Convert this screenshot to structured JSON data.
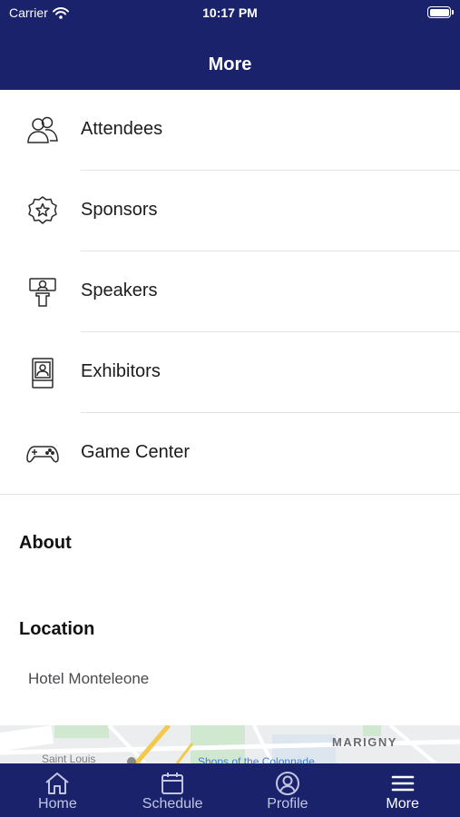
{
  "status_bar": {
    "carrier": "Carrier",
    "time": "10:17 PM",
    "wifi_icon": "wifi-icon",
    "battery_icon": "battery-icon"
  },
  "header": {
    "title": "More"
  },
  "menu": {
    "items": [
      {
        "label": "Attendees",
        "icon": "attendees-icon"
      },
      {
        "label": "Sponsors",
        "icon": "sponsor-badge-icon"
      },
      {
        "label": "Speakers",
        "icon": "speaker-podium-icon"
      },
      {
        "label": "Exhibitors",
        "icon": "exhibitor-booth-icon"
      },
      {
        "label": "Game Center",
        "icon": "game-controller-icon"
      }
    ]
  },
  "about": {
    "heading": "About"
  },
  "location": {
    "heading": "Location",
    "name": "Hotel Monteleone",
    "map": {
      "district_label": "MARIGNY",
      "street_label": "Saint Louis",
      "poi_label": "Shops of the Colonnade"
    }
  },
  "tabbar": {
    "tabs": [
      {
        "label": "Home",
        "icon": "home-icon",
        "active": false
      },
      {
        "label": "Schedule",
        "icon": "calendar-icon",
        "active": false
      },
      {
        "label": "Profile",
        "icon": "profile-icon",
        "active": false
      },
      {
        "label": "More",
        "icon": "menu-icon",
        "active": true
      }
    ]
  },
  "colors": {
    "brand_navy": "#19226a",
    "text": "#1c1c1e",
    "separator": "#e3e3e6",
    "inactive_tab": "#c3c6e0"
  }
}
